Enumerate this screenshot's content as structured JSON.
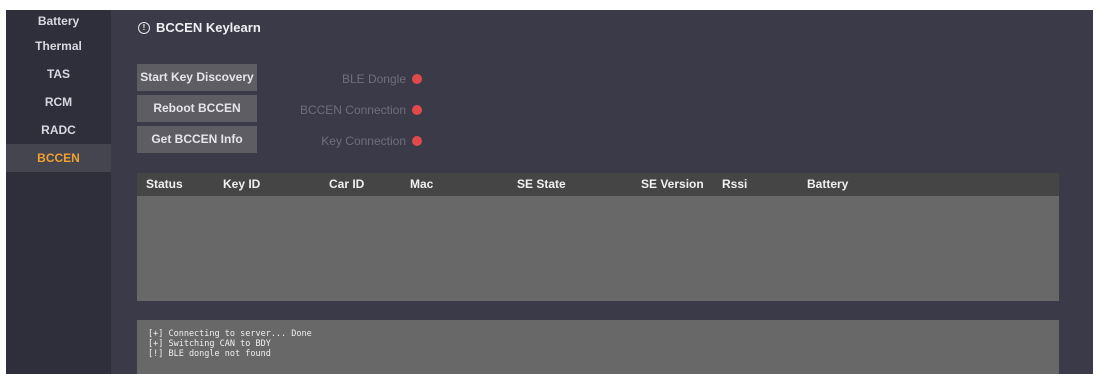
{
  "sidebar": {
    "items": [
      {
        "label": "Battery"
      },
      {
        "label": "Thermal"
      },
      {
        "label": "TAS"
      },
      {
        "label": "RCM"
      },
      {
        "label": "RADC"
      },
      {
        "label": "BCCEN",
        "active": true
      }
    ]
  },
  "header": {
    "icon": "info-icon",
    "info_glyph": "!",
    "title": "BCCEN Keylearn"
  },
  "buttons": {
    "start_discovery": "Start Key Discovery",
    "reboot": "Reboot BCCEN",
    "get_info": "Get BCCEN Info"
  },
  "status": [
    {
      "label": "BLE Dongle",
      "state": "error",
      "color": "#e04a4a"
    },
    {
      "label": "BCCEN Connection",
      "state": "error",
      "color": "#e04a4a"
    },
    {
      "label": "Key Connection",
      "state": "error",
      "color": "#e04a4a"
    }
  ],
  "table": {
    "columns": [
      "Status",
      "Key ID",
      "Car ID",
      "Mac",
      "SE State",
      "SE Version",
      "Rssi",
      "Battery"
    ],
    "rows": []
  },
  "log": [
    "[+] Connecting to server... Done",
    "[+] Switching CAN to BDY",
    "[!] BLE dongle not found"
  ],
  "colors": {
    "accent": "#f0a030",
    "error": "#e04a4a"
  }
}
